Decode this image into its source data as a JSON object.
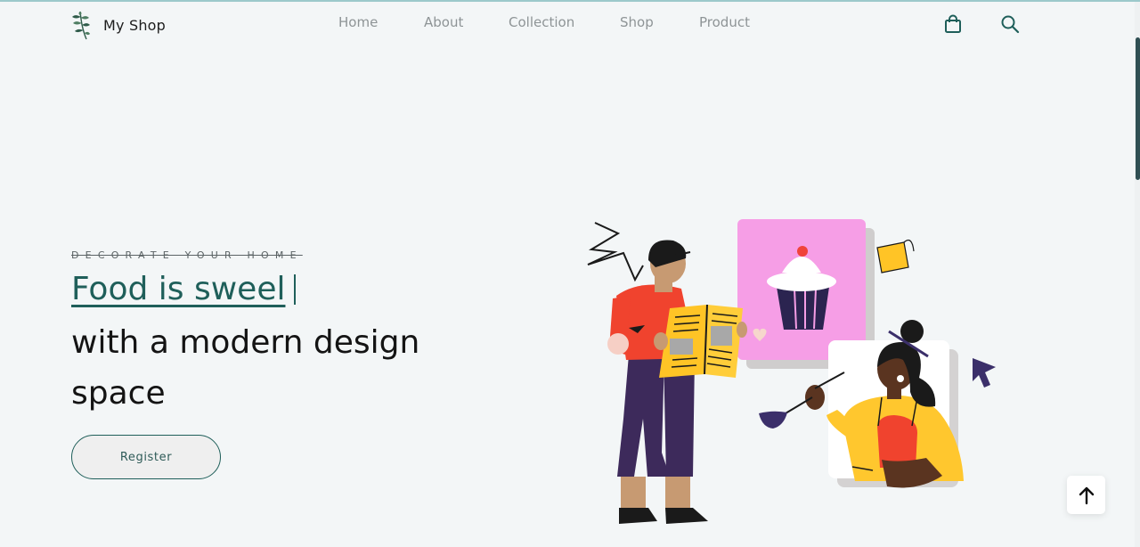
{
  "brand": {
    "name": "My Shop",
    "icon": "leaf-branch-icon",
    "accent_color": "#1f5f5a"
  },
  "nav": {
    "items": [
      {
        "label": "Home"
      },
      {
        "label": "About"
      },
      {
        "label": "Collection"
      },
      {
        "label": "Shop"
      },
      {
        "label": "Product"
      }
    ]
  },
  "header_icons": {
    "bag": "shopping-bag-icon",
    "search": "search-icon"
  },
  "hero": {
    "eyebrow": "DECORATE YOUR HOME",
    "headline_accent": "Food is sweel",
    "headline": "with a modern design space",
    "register_label": "Register"
  },
  "back_to_top": {
    "icon": "arrow-up-icon"
  }
}
